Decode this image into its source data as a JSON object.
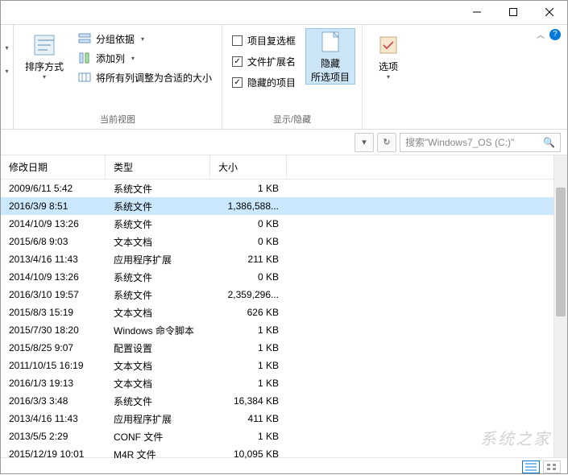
{
  "window": {
    "minimize": "—",
    "maximize": "☐",
    "close": "✕"
  },
  "ribbon": {
    "sort": {
      "label": "排序方式"
    },
    "group1": {
      "group_by": "分组依据",
      "add_column": "添加列",
      "fit_columns": "将所有列调整为合适的大小",
      "label": "当前视图"
    },
    "group2": {
      "item_checkboxes": "项目复选框",
      "file_ext": "文件扩展名",
      "hidden_items": "隐藏的项目",
      "hide_selected_l1": "隐藏",
      "hide_selected_l2": "所选项目",
      "label": "显示/隐藏"
    },
    "options": "选项"
  },
  "addr": {
    "refresh": "↻",
    "search_placeholder": "搜索\"Windows7_OS (C:)\""
  },
  "columns": {
    "date": "修改日期",
    "type": "类型",
    "size": "大小"
  },
  "rows": [
    {
      "date": "2009/6/11 5:42",
      "type": "系统文件",
      "size": "1 KB",
      "selected": false
    },
    {
      "date": "2016/3/9 8:51",
      "type": "系统文件",
      "size": "1,386,588...",
      "selected": true
    },
    {
      "date": "2014/10/9 13:26",
      "type": "系统文件",
      "size": "0 KB",
      "selected": false
    },
    {
      "date": "2015/6/8 9:03",
      "type": "文本文档",
      "size": "0 KB",
      "selected": false
    },
    {
      "date": "2013/4/16 11:43",
      "type": "应用程序扩展",
      "size": "211 KB",
      "selected": false
    },
    {
      "date": "2014/10/9 13:26",
      "type": "系统文件",
      "size": "0 KB",
      "selected": false
    },
    {
      "date": "2016/3/10 19:57",
      "type": "系统文件",
      "size": "2,359,296...",
      "selected": false
    },
    {
      "date": "2015/8/3 15:19",
      "type": "文本文档",
      "size": "626 KB",
      "selected": false
    },
    {
      "date": "2015/7/30 18:20",
      "type": "Windows 命令脚本",
      "size": "1 KB",
      "selected": false
    },
    {
      "date": "2015/8/25 9:07",
      "type": "配置设置",
      "size": "1 KB",
      "selected": false
    },
    {
      "date": "2011/10/15 16:19",
      "type": "文本文档",
      "size": "1 KB",
      "selected": false
    },
    {
      "date": "2016/1/3 19:13",
      "type": "文本文档",
      "size": "1 KB",
      "selected": false
    },
    {
      "date": "2016/3/3 3:48",
      "type": "系统文件",
      "size": "16,384 KB",
      "selected": false
    },
    {
      "date": "2013/4/16 11:43",
      "type": "应用程序扩展",
      "size": "411 KB",
      "selected": false
    },
    {
      "date": "2013/5/5 2:29",
      "type": "CONF 文件",
      "size": "1 KB",
      "selected": false
    },
    {
      "date": "2015/12/19 10:01",
      "type": "M4R 文件",
      "size": "10,095 KB",
      "selected": false
    }
  ],
  "watermark": "系统之家"
}
